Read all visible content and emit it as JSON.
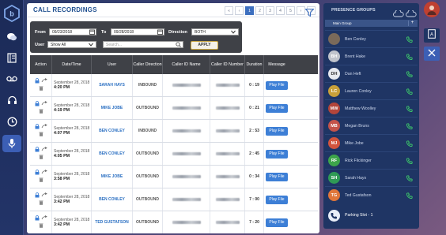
{
  "header": {
    "title": "CALL RECORDINGS",
    "pager": [
      "«",
      "‹",
      "1",
      "2",
      "3",
      "4",
      "5",
      "›",
      "»"
    ],
    "current_page": "1"
  },
  "filters": {
    "from_label": "From",
    "from_value": "09/23/2018",
    "to_label": "To",
    "to_value": "09/28/2018",
    "direction_label": "Direction",
    "direction_value": "BOTH",
    "user_label": "User",
    "user_value": "Show All",
    "search_placeholder": "Search...",
    "apply_label": "APPLY"
  },
  "table": {
    "columns": [
      "Action",
      "Date/Time",
      "User",
      "Caller Direction",
      "Caller ID Name",
      "Caller ID Number",
      "Duration",
      "Message"
    ],
    "rows": [
      {
        "date": "September 28, 2018",
        "time": "4:20 PM",
        "user": "SARAH HAYS",
        "direction": "INBOUND",
        "duration": "0 : 19",
        "message": "Play File"
      },
      {
        "date": "September 28, 2018",
        "time": "4:19 PM",
        "user": "MIKE JOBE",
        "direction": "OUTBOUND",
        "duration": "0 : 21",
        "message": "Play File"
      },
      {
        "date": "September 28, 2018",
        "time": "4:07 PM",
        "user": "BEN CONLEY",
        "direction": "INBOUND",
        "duration": "2 : 53",
        "message": "Play File"
      },
      {
        "date": "September 28, 2018",
        "time": "4:05 PM",
        "user": "BEN CONLEY",
        "direction": "OUTBOUND",
        "duration": "2 : 45",
        "message": "Play File"
      },
      {
        "date": "September 28, 2018",
        "time": "3:58 PM",
        "user": "MIKE JOBE",
        "direction": "OUTBOUND",
        "duration": "0 : 34",
        "message": "Play File"
      },
      {
        "date": "September 28, 2018",
        "time": "3:42 PM",
        "user": "BEN CONLEY",
        "direction": "OUTBOUND",
        "duration": "7 : 00",
        "message": "Play File"
      },
      {
        "date": "September 28, 2018",
        "time": "3:42 PM",
        "user": "TED GUSTAFSON",
        "direction": "OUTBOUND",
        "duration": "7 : 20",
        "message": "Play File"
      }
    ]
  },
  "presence": {
    "title": "PRESENCE GROUPS",
    "group_name": "Main Group",
    "group_add": "+",
    "members": [
      {
        "initials": "",
        "name": "Ben Conley",
        "color": "#7a6a5a"
      },
      {
        "initials": "BH",
        "name": "Brent Hake",
        "color": "#c0c4cc"
      },
      {
        "initials": "DH",
        "name": "Dan Heft",
        "color": "#e8eaef"
      },
      {
        "initials": "LC",
        "name": "Lauren Conley",
        "color": "#c9a13a"
      },
      {
        "initials": "MW",
        "name": "Matthew Woolley",
        "color": "#b2453a"
      },
      {
        "initials": "MB",
        "name": "Megan Bruns",
        "color": "#c4534a"
      },
      {
        "initials": "MJ",
        "name": "Mike Jobe",
        "color": "#d2543e"
      },
      {
        "initials": "RF",
        "name": "Rick Flickinger",
        "color": "#3da54a"
      },
      {
        "initials": "SH",
        "name": "Sarah Hays",
        "color": "#2f9a55"
      },
      {
        "initials": "TG",
        "name": "Ted Gustafson",
        "color": "#e0763a"
      }
    ],
    "parking": "Parking Slot - 1"
  },
  "colors": {
    "accent": "#3d7fd6",
    "online": "#3fd06a",
    "header_dark": "#3f4147"
  }
}
